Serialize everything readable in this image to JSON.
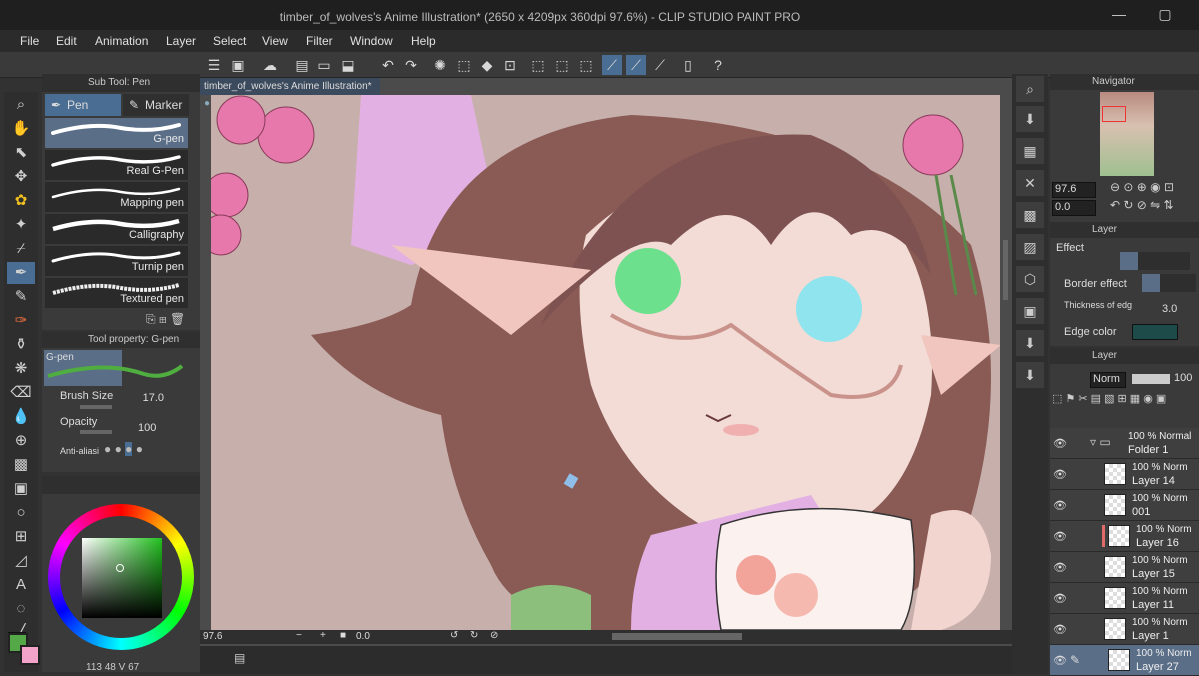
{
  "window": {
    "title": "timber_of_wolves's Anime Illustration* (2650 x 4209px 360dpi 97.6%) - CLIP STUDIO PAINT PRO"
  },
  "menu": [
    "File",
    "Edit",
    "Animation",
    "Layer",
    "Select",
    "View",
    "Filter",
    "Window",
    "Help"
  ],
  "subtool": {
    "header": "Sub Tool: Pen",
    "tabs": [
      "Pen",
      "Marker"
    ],
    "brushes": [
      "G-pen",
      "Real G-Pen",
      "Mapping pen",
      "Calligraphy",
      "Turnip pen",
      "Textured pen"
    ]
  },
  "toolprop": {
    "header": "Tool property: G-pen",
    "preview_name": "G-pen",
    "brush_size_label": "Brush Size",
    "brush_size": "17.0",
    "opacity_label": "Opacity",
    "opacity": "100",
    "antialias_label": "Anti-aliasi"
  },
  "color": {
    "main": "#55a847",
    "sub": "#f3a3c9",
    "hue_square": "#22c01f",
    "coords": "113 48 V 67"
  },
  "document_tab": "timber_of_wolves's Anime Illustration*",
  "status": {
    "zoom": "97.6",
    "angle": "0.0"
  },
  "navigator": {
    "header": "Navigator",
    "zoom": "97.6",
    "angle": "0.0"
  },
  "layer_property": {
    "tab": "Layer",
    "effect_label": "Effect",
    "border_effect_label": "Border effect",
    "thickness_label": "Thickness of edg",
    "thickness_value": "3.0",
    "edge_color_label": "Edge color",
    "edge_color": "#1d4b4a"
  },
  "layer_panel": {
    "tab": "Layer",
    "blend": "Norm",
    "opacity": "100",
    "layers": [
      {
        "line1": "100 % Normal",
        "line2": "Folder 1"
      },
      {
        "line1": "100 % Norm",
        "line2": "Layer 14"
      },
      {
        "line1": "100 % Norm",
        "line2": "001"
      },
      {
        "line1": "100 % Norm",
        "line2": "Layer 16"
      },
      {
        "line1": "100 % Norm",
        "line2": "Layer 15"
      },
      {
        "line1": "100 % Norm",
        "line2": "Layer 11"
      },
      {
        "line1": "100 % Norm",
        "line2": "Layer 1"
      },
      {
        "line1": "100 % Norm",
        "line2": "Layer 27"
      }
    ]
  }
}
